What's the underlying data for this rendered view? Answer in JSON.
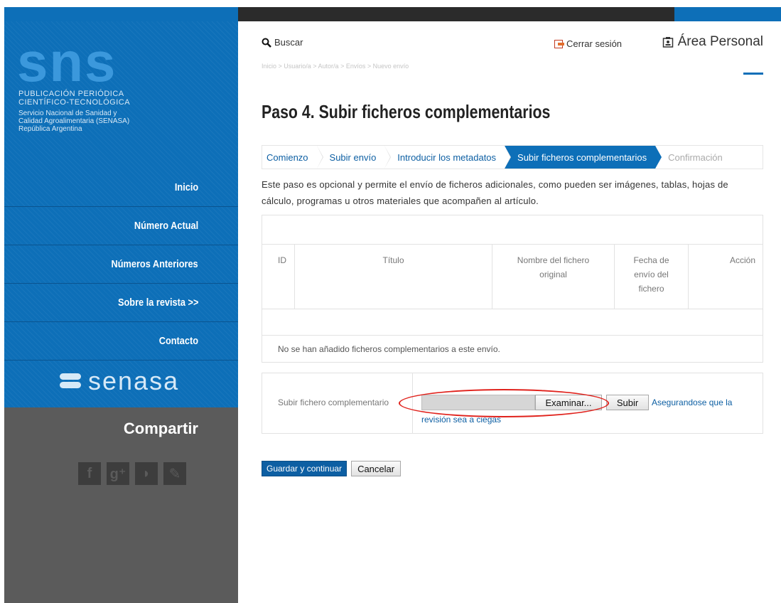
{
  "sidebar": {
    "logo_text": "sns",
    "publication_line1": "PUBLICACIÓN   PERIÓDICA",
    "publication_line2": "CIENTÍFICO-TECNOLÓGICA",
    "org_line1": "Servicio Nacional de Sanidad y",
    "org_line2": "Calidad Agroalimentaria (SENASA)",
    "org_line3": "República Argentina",
    "nav": [
      {
        "label": "Inicio"
      },
      {
        "label": "Número Actual"
      },
      {
        "label": "Números Anteriores"
      },
      {
        "label": "Sobre la revista >>"
      },
      {
        "label": "Contacto"
      }
    ],
    "partner_logo": "senasa",
    "share_title": "Compartir",
    "share_icons": [
      "facebook-icon",
      "google-plus-icon",
      "rss-icon",
      "twitter-icon"
    ]
  },
  "header": {
    "search_label": "Buscar",
    "logout_label": "Cerrar sesión",
    "personal_area_label": "Área Personal",
    "breadcrumb": "Inicio > Usuario/a > Autor/a > Envíos > Nuevo envío"
  },
  "main": {
    "title": "Paso 4. Subir ficheros complementarios",
    "steps": [
      {
        "label": "Comienzo"
      },
      {
        "label": "Subir envío"
      },
      {
        "label": "Introducir los metadatos"
      },
      {
        "label": "Subir ficheros complementarios"
      },
      {
        "label": "Confirmación"
      }
    ],
    "intro_text": "Este paso es opcional y permite el envío de ficheros adicionales, como pueden ser imágenes, tablas, hojas de cálculo, programas u otros materiales que acompañen al artículo.",
    "table": {
      "columns": {
        "id": "ID",
        "title": "Título",
        "original_name": "Nombre del fichero original",
        "date": "Fecha de envío del fichero",
        "action": "Acción"
      },
      "empty_message": "No se han añadido ficheros complementarios a este envío."
    },
    "upload": {
      "label": "Subir fichero complementario",
      "browse_label": "Examinar...",
      "upload_label": "Subir",
      "blind_review_link_part1": "Asegurandose que la",
      "blind_review_link_part2": "revisión sea a ciegas"
    },
    "actions": {
      "save_continue": "Guardar y continuar",
      "cancel": "Cancelar"
    }
  },
  "colors": {
    "brand_blue": "#0d6fb8",
    "sidebar_gray": "#5b5b5b",
    "annotation_red": "#e0221c"
  }
}
